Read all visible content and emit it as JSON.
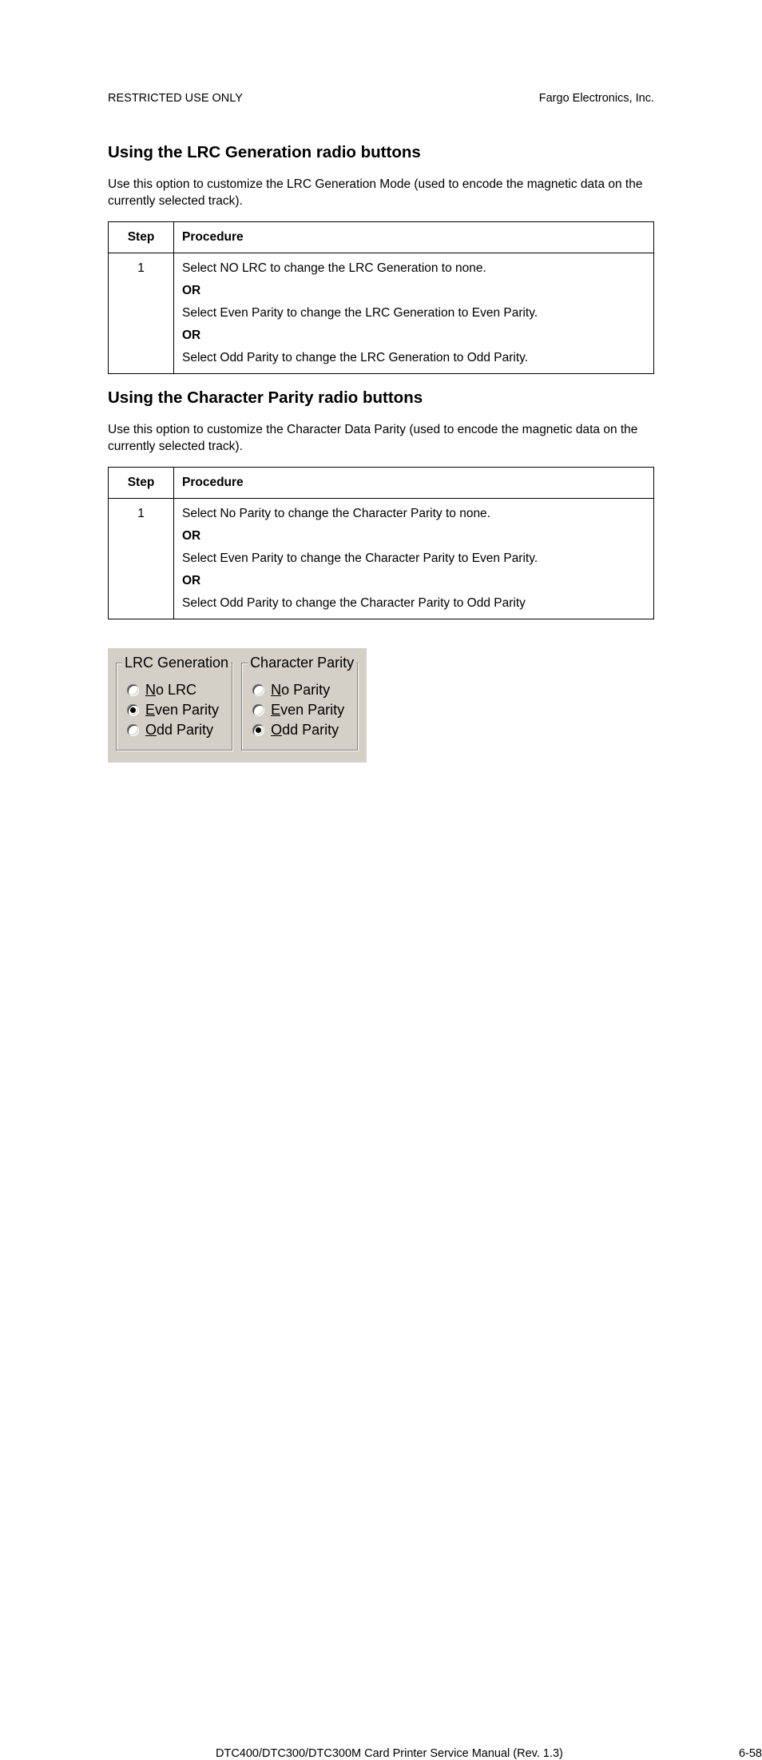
{
  "header": {
    "left": "RESTRICTED USE ONLY",
    "right": "Fargo Electronics, Inc."
  },
  "section1": {
    "title": "Using the LRC Generation radio buttons",
    "intro": "Use this option to customize the LRC Generation Mode (used to encode the magnetic data on the currently selected track).",
    "th_step": "Step",
    "th_proc": "Procedure",
    "step_num": "1",
    "lines": {
      "l1": "Select NO LRC to change the LRC Generation to none.",
      "or1": "OR",
      "l2": "Select Even Parity to change the LRC Generation to Even Parity.",
      "or2": "OR",
      "l3": "Select Odd Parity to change the LRC Generation to Odd Parity."
    }
  },
  "section2": {
    "title": "Using the Character Parity radio buttons",
    "intro": "Use this option to customize the Character Data Parity (used to encode the magnetic data on the currently selected track).",
    "th_step": "Step",
    "th_proc": "Procedure",
    "step_num": "1",
    "lines": {
      "l1": "Select No Parity to change the Character Parity to none.",
      "or1": "OR",
      "l2": "Select Even Parity to change the Character Parity to Even Parity.",
      "or2": "OR",
      "l3": "Select Odd Parity to change the Character Parity to Odd Parity"
    }
  },
  "ui": {
    "lrc": {
      "legend": "LRC Generation",
      "opt1": "No LRC",
      "opt2": "Even Parity",
      "opt3": "Odd Parity",
      "selected": 1
    },
    "char": {
      "legend": "Character Parity",
      "opt1": "No Parity",
      "opt2": "Even Parity",
      "opt3": "Odd Parity",
      "selected": 2
    }
  },
  "footer": {
    "left": "DTC400/DTC300/DTC300M Card Printer Service Manual (Rev. 1.3)",
    "right": "6-58"
  }
}
